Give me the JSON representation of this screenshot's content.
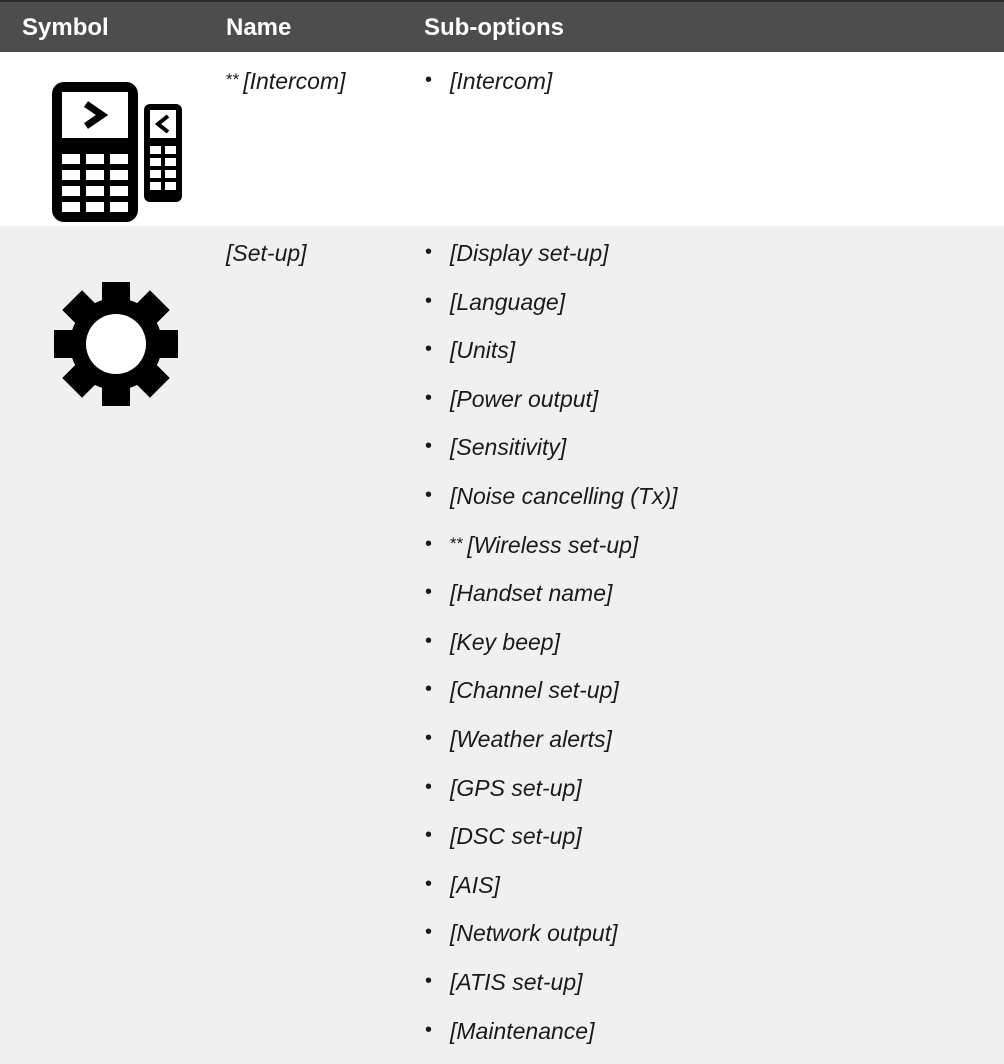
{
  "header": {
    "symbol": "Symbol",
    "name": "Name",
    "sub_options": "Sub-options"
  },
  "rows": [
    {
      "icon": "intercom-handsets-icon",
      "name_prefix": "**",
      "name": "[Intercom]",
      "sub_options": [
        {
          "prefix": "",
          "label": "[Intercom]"
        }
      ]
    },
    {
      "icon": "gear-icon",
      "name_prefix": "",
      "name": "[Set-up]",
      "sub_options": [
        {
          "prefix": "",
          "label": "[Display set-up]"
        },
        {
          "prefix": "",
          "label": "[Language]"
        },
        {
          "prefix": "",
          "label": "[Units]"
        },
        {
          "prefix": "",
          "label": "[Power output]"
        },
        {
          "prefix": "",
          "label": "[Sensitivity]"
        },
        {
          "prefix": "",
          "label": "[Noise cancelling (Tx)]"
        },
        {
          "prefix": "**",
          "label": "[Wireless set-up]"
        },
        {
          "prefix": "",
          "label": "[Handset name]"
        },
        {
          "prefix": "",
          "label": "[Key beep]"
        },
        {
          "prefix": "",
          "label": "[Channel set-up]"
        },
        {
          "prefix": "",
          "label": "[Weather alerts]"
        },
        {
          "prefix": "",
          "label": "[GPS set-up]"
        },
        {
          "prefix": "",
          "label": "[DSC set-up]"
        },
        {
          "prefix": "",
          "label": "[AIS]"
        },
        {
          "prefix": "",
          "label": "[Network output]"
        },
        {
          "prefix": "",
          "label": "[ATIS set-up]"
        },
        {
          "prefix": "",
          "label": "[Maintenance]"
        }
      ]
    }
  ],
  "colors": {
    "header_bg": "#4d4d4d",
    "header_text": "#ffffff",
    "alt_row_bg": "#f0f0f0",
    "icon": "#000000"
  }
}
